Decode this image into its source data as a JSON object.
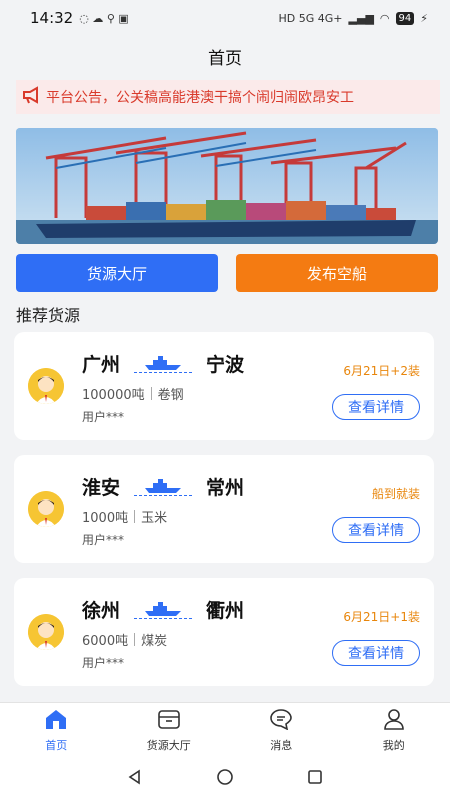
{
  "status_bar": {
    "time": "14:32",
    "network": "HD 5G 4G+",
    "battery": "94"
  },
  "header": {
    "title": "首页"
  },
  "notice": {
    "text": "平台公告，公关稿高能港澳干搞个闹归闹欧昂安工"
  },
  "actions": {
    "cargo_hall": "货源大厅",
    "publish_ship": "发布空船"
  },
  "section": {
    "title": "推荐货源"
  },
  "cargo_list": [
    {
      "from": "广州",
      "to": "宁波",
      "weight": "100000吨",
      "goods": "卷钢",
      "user": "用户***",
      "date": "6月21日+2装",
      "action": "查看详情"
    },
    {
      "from": "淮安",
      "to": "常州",
      "weight": "1000吨",
      "goods": "玉米",
      "user": "用户***",
      "date": "船到就装",
      "action": "查看详情"
    },
    {
      "from": "徐州",
      "to": "衢州",
      "weight": "6000吨",
      "goods": "煤炭",
      "user": "用户***",
      "date": "6月21日+1装",
      "action": "查看详情"
    }
  ],
  "tabbar": {
    "home": "首页",
    "cargo_hall": "货源大厅",
    "messages": "消息",
    "mine": "我的"
  },
  "colors": {
    "primary": "#2f6ef5",
    "accent": "#f47b12",
    "notice": "#d93a2b",
    "tag": "#e8860c"
  }
}
